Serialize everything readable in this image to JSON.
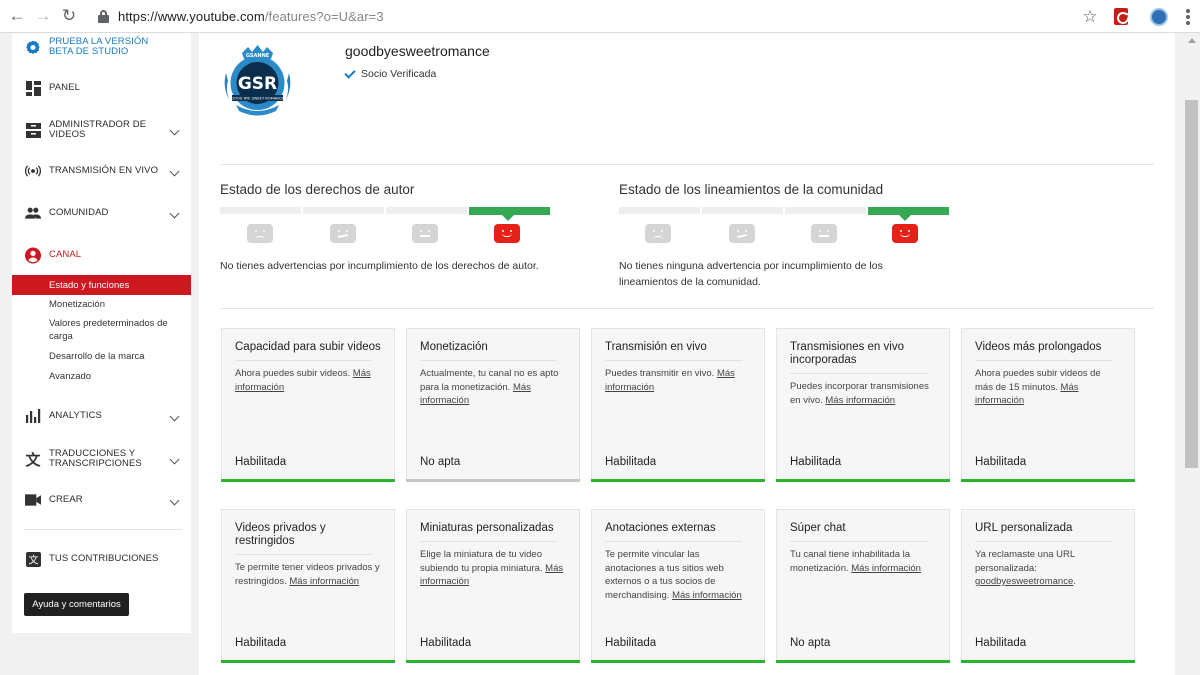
{
  "browser": {
    "url_host": "https://www.youtube.com",
    "url_path": "/features?o=U&ar=3"
  },
  "sidebar": {
    "studio_beta": "PRUEBA LA VERSIÓN BETA DE STUDIO",
    "items": [
      {
        "label": "PANEL"
      },
      {
        "label": "ADMINISTRADOR DE VIDEOS"
      },
      {
        "label": "TRANSMISIÓN EN VIVO"
      },
      {
        "label": "COMUNIDAD"
      },
      {
        "label": "CANAL"
      },
      {
        "label": "ANALYTICS"
      },
      {
        "label": "TRADUCCIONES Y TRANSCRIPCIONES"
      },
      {
        "label": "CREAR"
      },
      {
        "label": "TUS CONTRIBUCIONES"
      }
    ],
    "sub_items": [
      {
        "label": "Estado y funciones"
      },
      {
        "label": "Monetización"
      },
      {
        "label": "Valores predeterminados de carga"
      },
      {
        "label": "Desarrollo de la marca"
      },
      {
        "label": "Avanzado"
      }
    ],
    "help_button": "Ayuda y comentarios"
  },
  "channel": {
    "name": "goodbyesweetromance",
    "verified": "Socio Verificada",
    "avatar_text": "GSR",
    "avatar_badge": "GSANNE",
    "avatar_banner": "GOOD BYE SWEET ROMANCE"
  },
  "copyright": {
    "title": "Estado de los derechos de autor",
    "description": "No tienes advertencias por incumplimiento de los derechos de autor."
  },
  "guidelines": {
    "title": "Estado de los lineamientos de la comunidad",
    "description": "No tienes ninguna advertencia por incumplimiento de los lineamientos de la comunidad."
  },
  "features": [
    {
      "title": "Capacidad para subir videos",
      "desc": "Ahora puedes subir videos.",
      "more": "Más información",
      "status": "Habilitada",
      "enabled": true
    },
    {
      "title": "Monetización",
      "desc": "Actualmente, tu canal no es apto para la monetización.",
      "more": "Más información",
      "status": "No apta",
      "enabled": false
    },
    {
      "title": "Transmisión en vivo",
      "desc": "Puedes transmitir en vivo.",
      "more": "Más información",
      "status": "Habilitada",
      "enabled": true
    },
    {
      "title": "Transmisiones en vivo incorporadas",
      "desc": "Puedes incorporar transmisiones en vivo.",
      "more": "Más información",
      "status": "Habilitada",
      "enabled": true
    },
    {
      "title": "Videos más prolongados",
      "desc": "Ahora puedes subir videos de más de 15 minutos.",
      "more": "Más información",
      "status": "Habilitada",
      "enabled": true
    },
    {
      "title": "Videos privados y restringidos",
      "desc": "Te permite tener videos privados y restringidos.",
      "more": "Más información",
      "status": "Habilitada",
      "enabled": true
    },
    {
      "title": "Miniaturas personalizadas",
      "desc": "Elige la miniatura de tu video subiendo tu propia miniatura.",
      "more": "Más información",
      "status": "Habilitada",
      "enabled": true
    },
    {
      "title": "Anotaciones externas",
      "desc": "Te permite vincular las anotaciones a tus sitios web externos o a tus socios de merchandising.",
      "more": "Más información",
      "status": "Habilitada",
      "enabled": true
    },
    {
      "title": "Súper chat",
      "desc": "Tu canal tiene inhabilitada la monetización.",
      "more": "Más información",
      "status": "No apta",
      "enabled": true
    },
    {
      "title": "URL personalizada",
      "desc": "Ya reclamaste una URL personalizada:",
      "more": "goodbyesweetromance",
      "suffix": ".",
      "status": "Habilitada",
      "enabled": true
    }
  ]
}
